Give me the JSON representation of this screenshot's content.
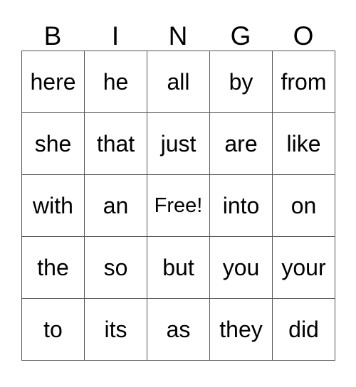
{
  "card": {
    "header_letters": [
      "B",
      "I",
      "N",
      "G",
      "O"
    ],
    "rows": [
      [
        "here",
        "he",
        "all",
        "by",
        "from"
      ],
      [
        "she",
        "that",
        "just",
        "are",
        "like"
      ],
      [
        "with",
        "an",
        "Free!",
        "into",
        "on"
      ],
      [
        "the",
        "so",
        "but",
        "you",
        "your"
      ],
      [
        "to",
        "its",
        "as",
        "they",
        "did"
      ]
    ],
    "free_space": {
      "row": 2,
      "col": 2,
      "label": "Free!"
    },
    "colors": {
      "background": "#ffffff",
      "text": "#000000",
      "grid_line": "#555555"
    }
  }
}
